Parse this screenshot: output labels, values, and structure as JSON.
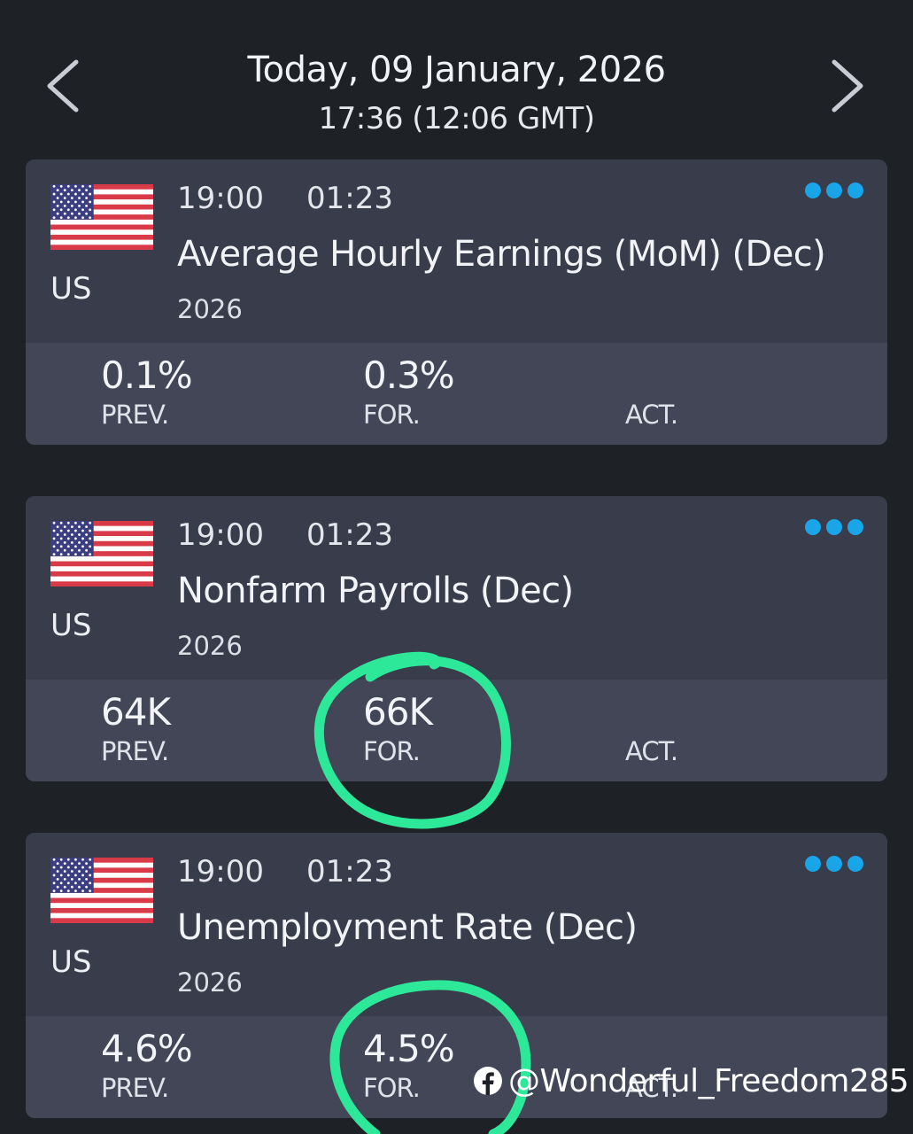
{
  "header": {
    "date": "Today, 09 January, 2026",
    "time": "17:36 (12:06 GMT)",
    "prev_icon": "chevron-left-icon",
    "next_icon": "chevron-right-icon"
  },
  "events": [
    {
      "country": "US",
      "flag": "us-flag-icon",
      "time": "19:00",
      "countdown": "01:23",
      "title": "Average Hourly Earnings (MoM)  (Dec)",
      "year": "2026",
      "prev": "0.1%",
      "forecast": "0.3%",
      "actual": "",
      "labels": {
        "prev": "PREV.",
        "forecast": "FOR.",
        "actual": "ACT."
      }
    },
    {
      "country": "US",
      "flag": "us-flag-icon",
      "time": "19:00",
      "countdown": "01:23",
      "title": "Nonfarm Payrolls  (Dec)",
      "year": "2026",
      "prev": "64K",
      "forecast": "66K",
      "actual": "",
      "labels": {
        "prev": "PREV.",
        "forecast": "FOR.",
        "actual": "ACT."
      }
    },
    {
      "country": "US",
      "flag": "us-flag-icon",
      "time": "19:00",
      "countdown": "01:23",
      "title": "Unemployment Rate  (Dec)",
      "year": "2026",
      "prev": "4.6%",
      "forecast": "4.5%",
      "actual": "",
      "labels": {
        "prev": "PREV.",
        "forecast": "FOR.",
        "actual": "ACT."
      }
    }
  ],
  "watermark": {
    "text": "@Wonderful_Freedom285",
    "icon": "facebook-icon"
  },
  "colors": {
    "background": "#1e2125",
    "card": "#383c4b",
    "card_values": "#424656",
    "accent_dots": "#1aa5e8",
    "highlight": "#2ee89a"
  }
}
